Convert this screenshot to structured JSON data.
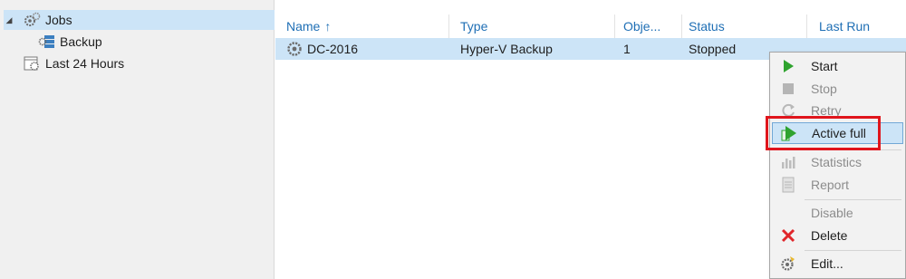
{
  "tree": {
    "items": [
      {
        "label": "Jobs",
        "icon": "gears-icon",
        "expanded": true,
        "selected": true
      },
      {
        "label": "Backup",
        "icon": "backup-job-icon"
      },
      {
        "label": "Last 24 Hours",
        "icon": "calendar-gear-icon"
      }
    ]
  },
  "table": {
    "columns": [
      "Name",
      "Type",
      "Obje...",
      "Status",
      "Last Run"
    ],
    "sort_indicator": "↑",
    "rows": [
      {
        "name": "DC-2016",
        "type": "Hyper-V Backup",
        "objects": "1",
        "status": "Stopped",
        "last_run": ""
      }
    ]
  },
  "context_menu": {
    "items": [
      {
        "label": "Start",
        "icon": "play-icon",
        "enabled": true
      },
      {
        "label": "Stop",
        "icon": "stop-icon",
        "enabled": false
      },
      {
        "label": "Retry",
        "icon": "retry-icon",
        "enabled": false
      },
      {
        "label": "Active full",
        "icon": "active-full-icon",
        "enabled": true,
        "highlighted": true
      },
      {
        "label": "Statistics",
        "icon": "statistics-icon",
        "enabled": false
      },
      {
        "label": "Report",
        "icon": "report-icon",
        "enabled": false
      },
      {
        "label": "Disable",
        "icon": "",
        "enabled": false
      },
      {
        "label": "Delete",
        "icon": "delete-icon",
        "enabled": true
      },
      {
        "label": "Edit...",
        "icon": "edit-gear-icon",
        "enabled": true
      }
    ]
  },
  "colors": {
    "selection": "#cce4f7",
    "header_text": "#1f6fb5",
    "callout": "#e0151c",
    "play_green": "#2fa32f",
    "delete_red": "#e0262b"
  }
}
